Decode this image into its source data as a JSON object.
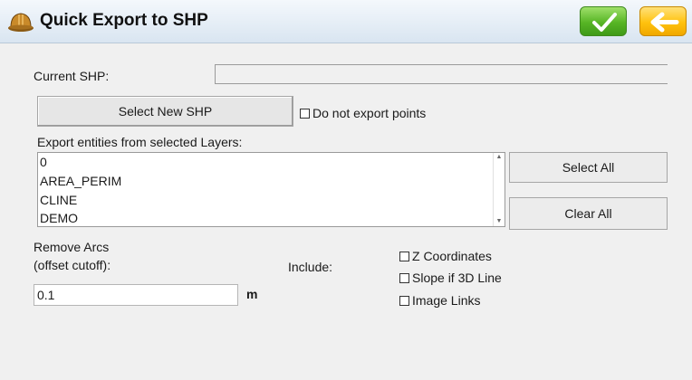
{
  "title": "Quick Export to SHP",
  "icons": {
    "title": "hard-hat-icon",
    "ok": "checkmark-icon",
    "back": "arrow-left-icon"
  },
  "colors": {
    "ok_button": "#57b525",
    "back_button": "#ffc20e"
  },
  "current_shp": {
    "label": "Current SHP:",
    "value": ""
  },
  "select_new_shp_label": "Select New SHP",
  "do_not_export_points": {
    "label": "Do not export points",
    "checked": false
  },
  "layers": {
    "label": "Export entities from selected Layers:",
    "items": [
      "0",
      "AREA_PERIM",
      "CLINE",
      "DEMO"
    ]
  },
  "select_all_label": "Select All",
  "clear_all_label": "Clear All",
  "remove_arcs": {
    "label_line1": "Remove Arcs",
    "label_line2": "(offset cutoff):",
    "value": "0.1",
    "unit": "m"
  },
  "include": {
    "label": "Include:",
    "options": [
      {
        "label": "Z Coordinates",
        "checked": false
      },
      {
        "label": "Slope if 3D Line",
        "checked": false
      },
      {
        "label": "Image Links",
        "checked": false
      }
    ]
  }
}
